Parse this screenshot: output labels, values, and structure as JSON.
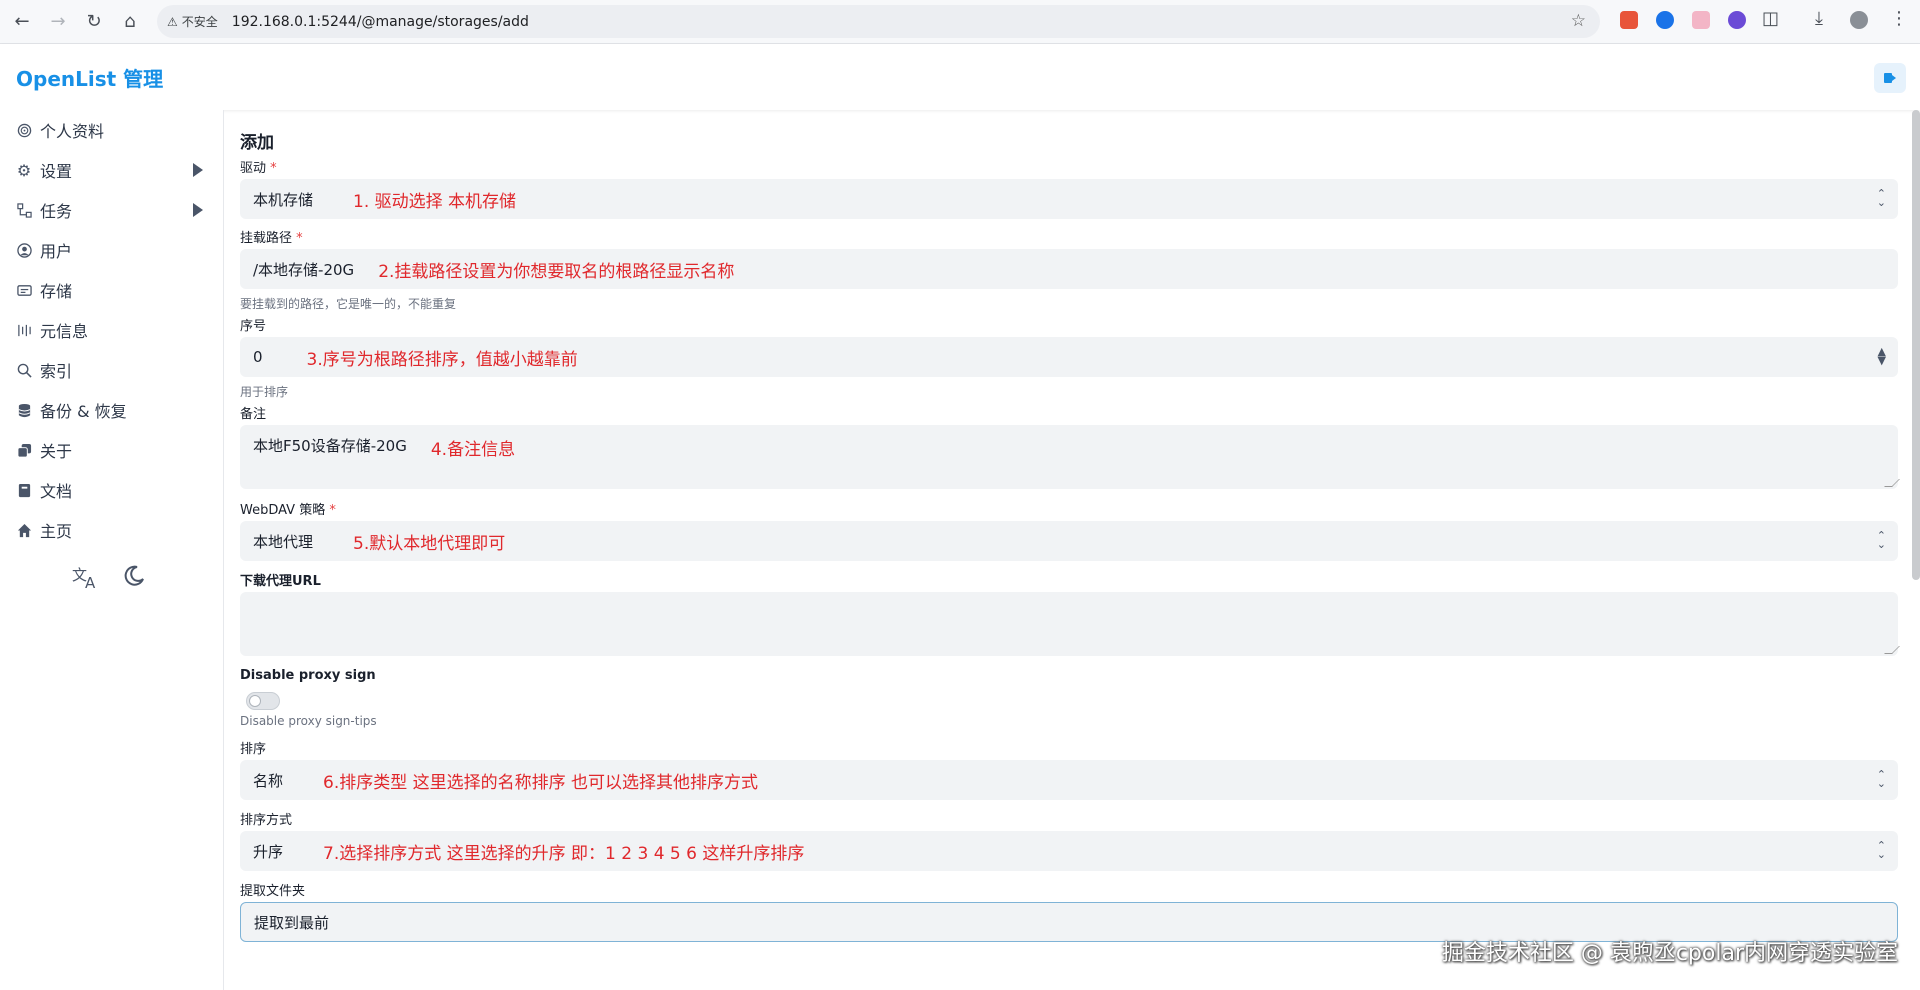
{
  "browser": {
    "insecure_label": "不安全",
    "url": "192.168.0.1:5244/@manage/storages/add"
  },
  "app": {
    "brand": "OpenList 管理"
  },
  "sidebar": {
    "items": [
      {
        "label": "个人资料",
        "icon": "fingerprint-icon"
      },
      {
        "label": "设置",
        "icon": "gear-icon",
        "expandable": true
      },
      {
        "label": "任务",
        "icon": "tasks-icon",
        "expandable": true
      },
      {
        "label": "用户",
        "icon": "user-icon"
      },
      {
        "label": "存储",
        "icon": "storage-icon"
      },
      {
        "label": "元信息",
        "icon": "meta-icon"
      },
      {
        "label": "索引",
        "icon": "search-icon"
      },
      {
        "label": "备份 & 恢复",
        "icon": "database-icon"
      },
      {
        "label": "关于",
        "icon": "copy-icon"
      },
      {
        "label": "文档",
        "icon": "book-icon"
      },
      {
        "label": "主页",
        "icon": "home-icon"
      }
    ]
  },
  "form": {
    "title": "添加",
    "driver": {
      "label": "驱动",
      "value": "本机存储",
      "annotation": "1. 驱动选择 本机存储"
    },
    "mount_path": {
      "label": "挂载路径",
      "value": "/本地存储-20G",
      "annotation": "2.挂载路径设置为你想要取名的根路径显示名称",
      "help": "要挂载到的路径，它是唯一的，不能重复"
    },
    "order": {
      "label": "序号",
      "value": "0",
      "annotation": "3.序号为根路径排序，值越小越靠前",
      "help": "用于排序"
    },
    "remark": {
      "label": "备注",
      "value": "本地F50设备存储-20G",
      "annotation": "4.备注信息"
    },
    "webdav": {
      "label": "WebDAV 策略",
      "value": "本地代理",
      "annotation": "5.默认本地代理即可"
    },
    "proxy_url": {
      "label": "下载代理URL",
      "value": ""
    },
    "disable_proxy_sign": {
      "label": "Disable proxy sign",
      "enabled": false,
      "help": "Disable proxy sign-tips"
    },
    "sort": {
      "label": "排序",
      "value": "名称",
      "annotation": "6.排序类型  这里选择的名称排序  也可以选择其他排序方式"
    },
    "sort_dir": {
      "label": "排序方式",
      "value": "升序",
      "annotation": "7.选择排序方式 这里选择的升序  即：1 2 3 4 5 6  这样升序排序"
    },
    "extract_folder": {
      "label": "提取文件夹",
      "value": "提取到最前"
    }
  },
  "watermark": "掘金技术社区 @ 袁煦丞cpolar内网穿透实验室"
}
